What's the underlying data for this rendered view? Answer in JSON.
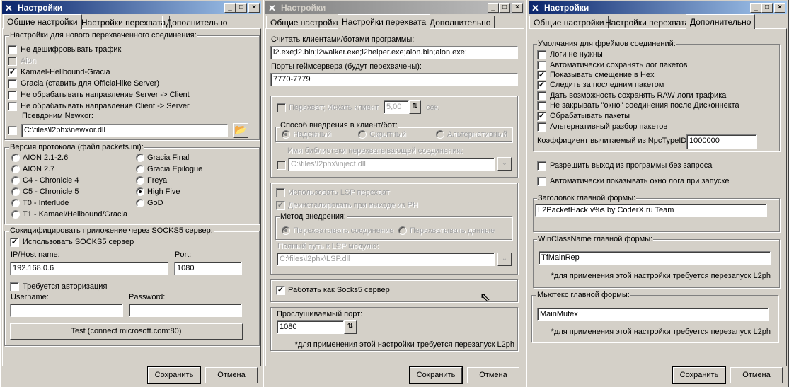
{
  "common": {
    "title": "Настройки",
    "tabs": [
      "Общие настройки",
      "Настройки перехвата",
      "Дополнительно"
    ],
    "save": "Сохранить",
    "cancel": "Отмена",
    "restart_note": "*для применения этой настройки требуется перезапуск L2ph"
  },
  "w1": {
    "g1": {
      "legend": "Настройки для нового перехваченного соединения:",
      "items": [
        {
          "label": "Не дешифровывать трафик",
          "checked": false
        },
        {
          "label": "Aion",
          "checked": false,
          "disabled": true
        },
        {
          "label": "Kamael-Hellbound-Gracia",
          "checked": true
        },
        {
          "label": "Gracia (ставить для Official-like Server)",
          "checked": false
        },
        {
          "label": "Не обрабатывать направление Server -> Client",
          "checked": false
        },
        {
          "label": "Не обрабатывать направление Client -> Server",
          "checked": false
        }
      ],
      "newxor_label": "Псевдоним Newxor:",
      "newxor_path": "C:\\files\\l2phx\\newxor.dll"
    },
    "g2": {
      "legend": "Версия протокола (файл packets.ini):",
      "left": [
        "AION 2.1-2.6",
        "AION 2.7",
        "C4 - Chronicle 4",
        "C5 - Chronicle 5",
        "T0 - Interlude",
        "T1 - Kamael/Hellbound/Gracia"
      ],
      "right": [
        "Gracia Final",
        "Gracia Epilogue",
        "Freya",
        "High Five",
        "GoD"
      ],
      "selected": "High Five"
    },
    "g3": {
      "legend": "Сокицифицировать приложение через SOCKS5 сервер:",
      "use_socks": "Использовать SOCKS5 сервер",
      "host_label": "IP/Host name:",
      "host": "192.168.0.6",
      "port_label": "Port:",
      "port": "1080",
      "auth": "Требуется авторизация",
      "user_label": "Username:",
      "pass_label": "Password:",
      "user": "",
      "pass": "",
      "test": "Test (connect microsoft.com:80)"
    }
  },
  "w2": {
    "clients_label": "Считать клиентами/ботами программы:",
    "clients": "l2.exe;l2.bin;l2walker.exe;l2helper.exe;aion.bin;aion.exe;",
    "ports_label": "Порты геймсервера (будут перехвачены):",
    "ports": "7770-7779",
    "intercept": "Перехват; Искать клиент",
    "interval": "5,00",
    "sec": "сек.",
    "inject_legend": "Способ внедрения в клиент/бот:",
    "inject_opts": [
      "Надежный",
      "Скрытный",
      "Альтернативный"
    ],
    "lib_label": "Имя библиотеки перехватывающей соединения:",
    "lib_path": "C:\\files\\l2phx\\inject.dll",
    "use_lsp": "Использовать LSP перехват",
    "uninstall": "Деинсталировать при выходе из PH",
    "method_legend": "Метод внедрения:",
    "method_opts": [
      "Перехватывать соединение",
      "Перехватывать данные"
    ],
    "lsp_label": "Полный путь к LSP модулю:",
    "lsp_path": "C:\\files\\l2phx\\LSP.dll",
    "socks_server": "Работать как Socks5 сервер",
    "listen_label": "Прослушиваемый порт:",
    "listen_port": "1080"
  },
  "w3": {
    "legend": "Умолчания для фреймов соединений:",
    "items": [
      {
        "label": "Логи не нужны",
        "checked": false
      },
      {
        "label": "Автоматически сохранять лог пакетов",
        "checked": false
      },
      {
        "label": "Показывать смещение в Hex",
        "checked": true
      },
      {
        "label": "Следить за последним пакетом",
        "checked": true
      },
      {
        "label": "Дать возможность сохранять RAW логи трафика",
        "checked": false
      },
      {
        "label": "Не закрывать \"окно\" соединения после Дисконнекта",
        "checked": false
      },
      {
        "label": "Обрабатывать пакеты",
        "checked": true
      },
      {
        "label": "Альтернативный разбор пакетов",
        "checked": false
      }
    ],
    "npc_label": "Коэффициент вычитаемый из NpcTypeID",
    "npc_value": "1000000",
    "allow_exit": "Разрешить выход из программы без запроса",
    "show_log": "Автоматически показывать окно лога при запуске",
    "caption_legend": "Заголовок главной формы:",
    "caption": "L2PacketHack v%s by CoderX.ru Team",
    "class_legend": "WinClassName главной формы:",
    "class": "TfMainRep",
    "mutex_legend": "Мьютекс главной формы:",
    "mutex": "MainMutex"
  }
}
